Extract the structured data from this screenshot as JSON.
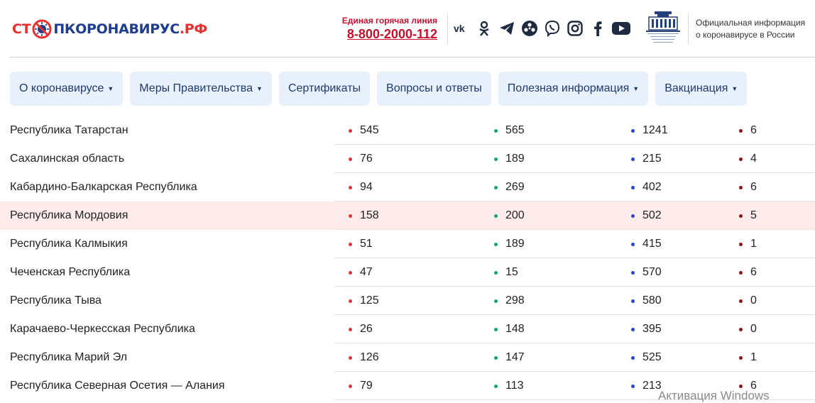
{
  "logo": {
    "part1": "СТ",
    "part2": "ПКОРОНАВИРУС",
    "part3": ".РФ"
  },
  "hotline": {
    "caption": "Единая горячая линия",
    "number": "8-800-2000-112"
  },
  "socials": [
    "vk-icon",
    "odnoklassniki-icon",
    "telegram-icon",
    "rutube-icon",
    "viber-icon",
    "instagram-icon",
    "facebook-icon",
    "youtube-icon"
  ],
  "government": {
    "line1": "Официальная информация",
    "line2": "о коронавирусе в России"
  },
  "nav": [
    {
      "label": "О коронавирусе",
      "dropdown": true
    },
    {
      "label": "Меры Правительства",
      "dropdown": true
    },
    {
      "label": "Сертификаты",
      "dropdown": false
    },
    {
      "label": "Вопросы и ответы",
      "dropdown": false
    },
    {
      "label": "Полезная информация",
      "dropdown": true
    },
    {
      "label": "Вакцинация",
      "dropdown": true
    }
  ],
  "table": [
    {
      "region": "Республика Татарстан",
      "c1": "545",
      "c2": "565",
      "c3": "1241",
      "c4": "6",
      "highlight": false
    },
    {
      "region": "Сахалинская область",
      "c1": "76",
      "c2": "189",
      "c3": "215",
      "c4": "4",
      "highlight": false
    },
    {
      "region": "Кабардино-Балкарская Республика",
      "c1": "94",
      "c2": "269",
      "c3": "402",
      "c4": "6",
      "highlight": false
    },
    {
      "region": "Республика Мордовия",
      "c1": "158",
      "c2": "200",
      "c3": "502",
      "c4": "5",
      "highlight": true
    },
    {
      "region": "Республика Калмыкия",
      "c1": "51",
      "c2": "189",
      "c3": "415",
      "c4": "1",
      "highlight": false
    },
    {
      "region": "Чеченская Республика",
      "c1": "47",
      "c2": "15",
      "c3": "570",
      "c4": "6",
      "highlight": false
    },
    {
      "region": "Республика Тыва",
      "c1": "125",
      "c2": "298",
      "c3": "580",
      "c4": "0",
      "highlight": false
    },
    {
      "region": "Карачаево-Черкесская Республика",
      "c1": "26",
      "c2": "148",
      "c3": "395",
      "c4": "0",
      "highlight": false
    },
    {
      "region": "Республика Марий Эл",
      "c1": "126",
      "c2": "147",
      "c3": "525",
      "c4": "1",
      "highlight": false
    },
    {
      "region": "Республика Северная Осетия — Алания",
      "c1": "79",
      "c2": "113",
      "c3": "213",
      "c4": "6",
      "highlight": false
    }
  ],
  "watermark": "Активация Windows",
  "colors": {
    "accent_red": "#e8312f",
    "brand_blue": "#1f3d8f",
    "nav_bg": "#e8f0fc",
    "highlight_row": "#fdebeb"
  }
}
